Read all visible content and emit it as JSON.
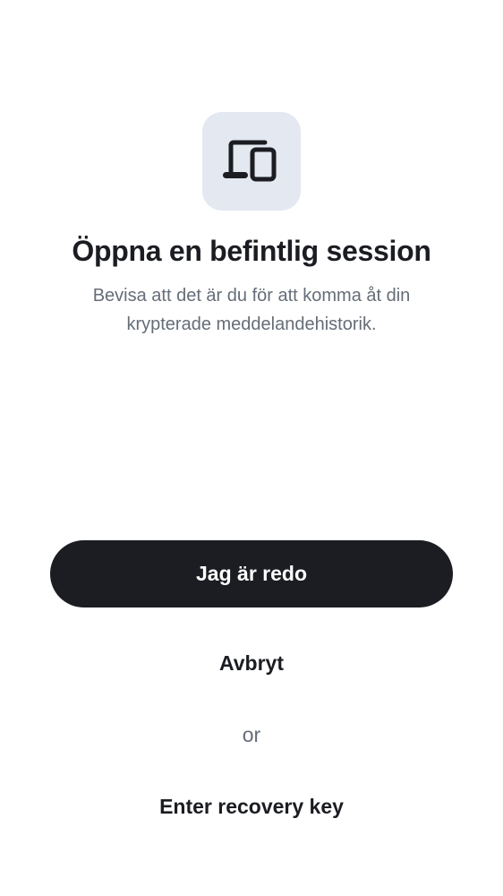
{
  "header": {
    "icon": "devices-icon",
    "title": "Öppna en befintlig session",
    "subtitle": "Bevisa att det är du för att komma åt din krypterade meddelandehistorik."
  },
  "actions": {
    "primary_label": "Jag är redo",
    "cancel_label": "Avbryt",
    "or_label": "or",
    "recovery_label": "Enter recovery key"
  },
  "colors": {
    "background": "#ffffff",
    "icon_tile": "#e3e8f1",
    "primary": "#1b1d22",
    "secondary_text": "#656d77"
  }
}
